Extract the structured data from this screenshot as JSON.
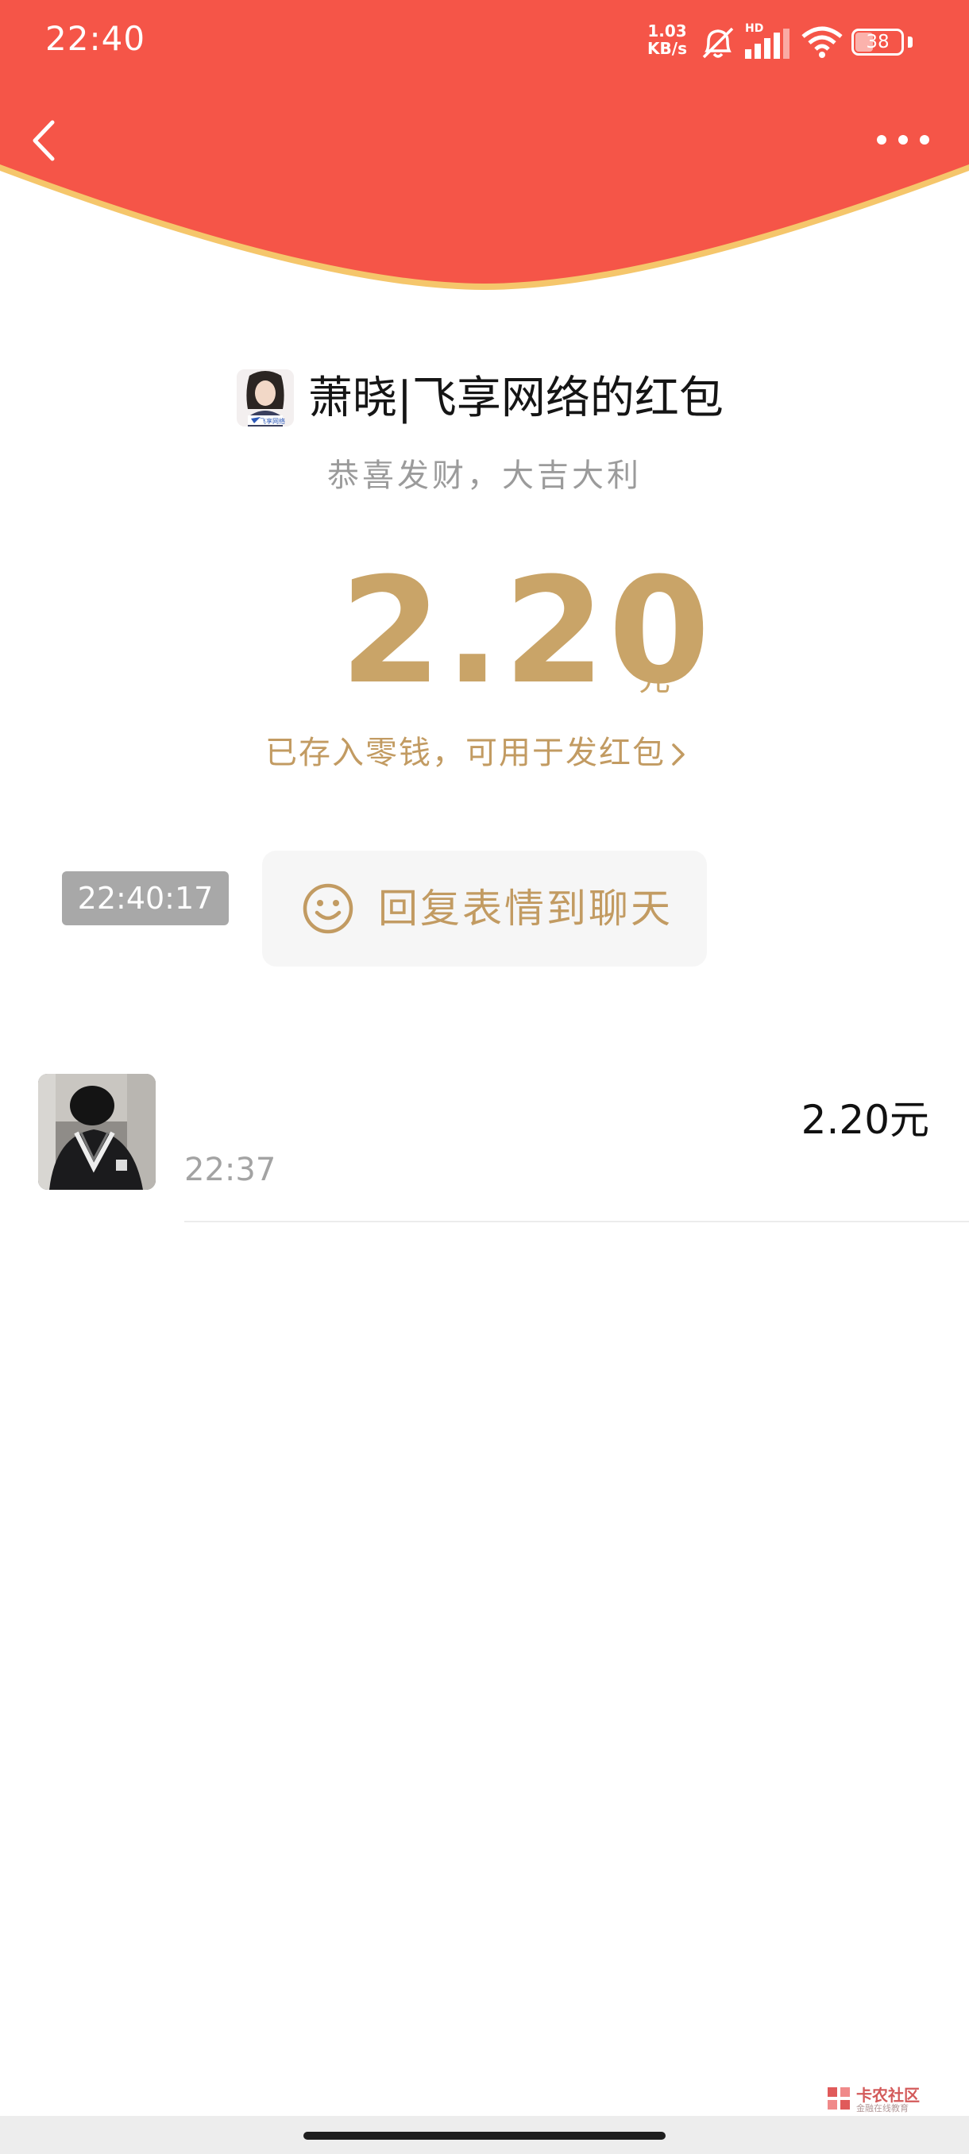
{
  "status_bar": {
    "time": "22:40",
    "net_speed_value": "1.03",
    "net_speed_unit": "KB/s",
    "network_type": "HD",
    "battery_level": "38"
  },
  "colors": {
    "header_red": "#f55548",
    "header_rim": "#f5c66b",
    "gold": "#c9a468",
    "chip_gray": "#a8a8a8"
  },
  "nav": {
    "back_icon": "chevron-left-icon",
    "more_icon": "more-dots-icon"
  },
  "envelope": {
    "sender_title": "萧晓|飞享网络的红包",
    "greeting": "恭喜发财，大吉大利",
    "amount": "2.20",
    "amount_unit": "元",
    "saved_note": "已存入零钱，可用于发红包",
    "avatar_caption": "飞享网络"
  },
  "reply": {
    "timestamp": "22:40:17",
    "label": "回复表情到聊天",
    "icon": "smile-icon"
  },
  "records": [
    {
      "amount": "2.20元",
      "time": "22:37"
    }
  ],
  "watermark": {
    "name": "卡农社区",
    "subtitle": "金融在线教育"
  }
}
